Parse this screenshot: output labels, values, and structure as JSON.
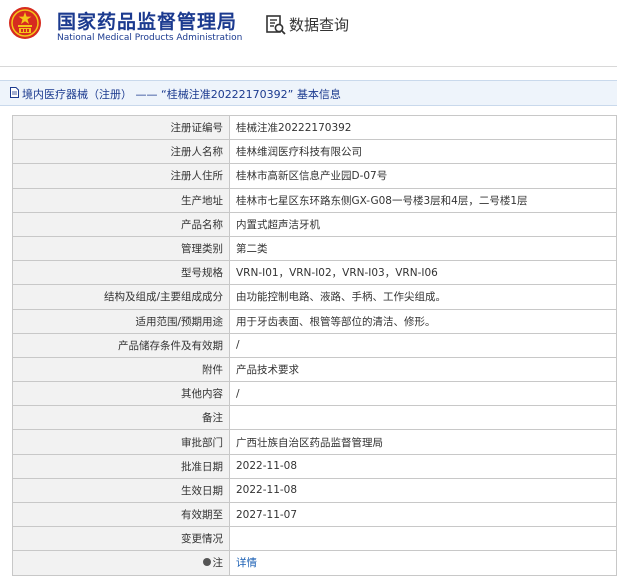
{
  "header": {
    "title_cn": "国家药品监督管理局",
    "title_en": "National Medical Products Administration",
    "query_label": "数据查询",
    "emblem_icon": "national-emblem-icon",
    "query_icon": "document-search-icon",
    "brand_color": "#1b3a8f"
  },
  "breadcrumb": {
    "icon": "document-icon",
    "text": "境内医疗器械（注册） —— “桂械注准20222170392” 基本信息"
  },
  "details": [
    {
      "label": "注册证编号",
      "value": "桂械注准20222170392"
    },
    {
      "label": "注册人名称",
      "value": "桂林维润医疗科技有限公司"
    },
    {
      "label": "注册人住所",
      "value": "桂林市高新区信息产业园D-07号"
    },
    {
      "label": "生产地址",
      "value": "桂林市七星区东环路东侧GX-G08一号楼3层和4层，二号楼1层"
    },
    {
      "label": "产品名称",
      "value": "内置式超声洁牙机"
    },
    {
      "label": "管理类别",
      "value": "第二类"
    },
    {
      "label": "型号规格",
      "value": "VRN-I01，VRN-I02，VRN-I03，VRN-I06"
    },
    {
      "label": "结构及组成/主要组成成分",
      "value": "由功能控制电路、液路、手柄、工作尖组成。"
    },
    {
      "label": "适用范围/预期用途",
      "value": "用于牙齿表面、根管等部位的清洁、修形。"
    },
    {
      "label": "产品储存条件及有效期",
      "value": "/"
    },
    {
      "label": "附件",
      "value": "产品技术要求"
    },
    {
      "label": "其他内容",
      "value": "/"
    },
    {
      "label": "备注",
      "value": ""
    },
    {
      "label": "审批部门",
      "value": "广西壮族自治区药品监督管理局"
    },
    {
      "label": "批准日期",
      "value": "2022-11-08"
    },
    {
      "label": "生效日期",
      "value": "2022-11-08"
    },
    {
      "label": "有效期至",
      "value": "2027-11-07"
    },
    {
      "label": "变更情况",
      "value": ""
    }
  ],
  "note": {
    "icon": "info-dot-icon",
    "label": "注",
    "link_text": "详情",
    "link_color": "#1a5fb4"
  }
}
